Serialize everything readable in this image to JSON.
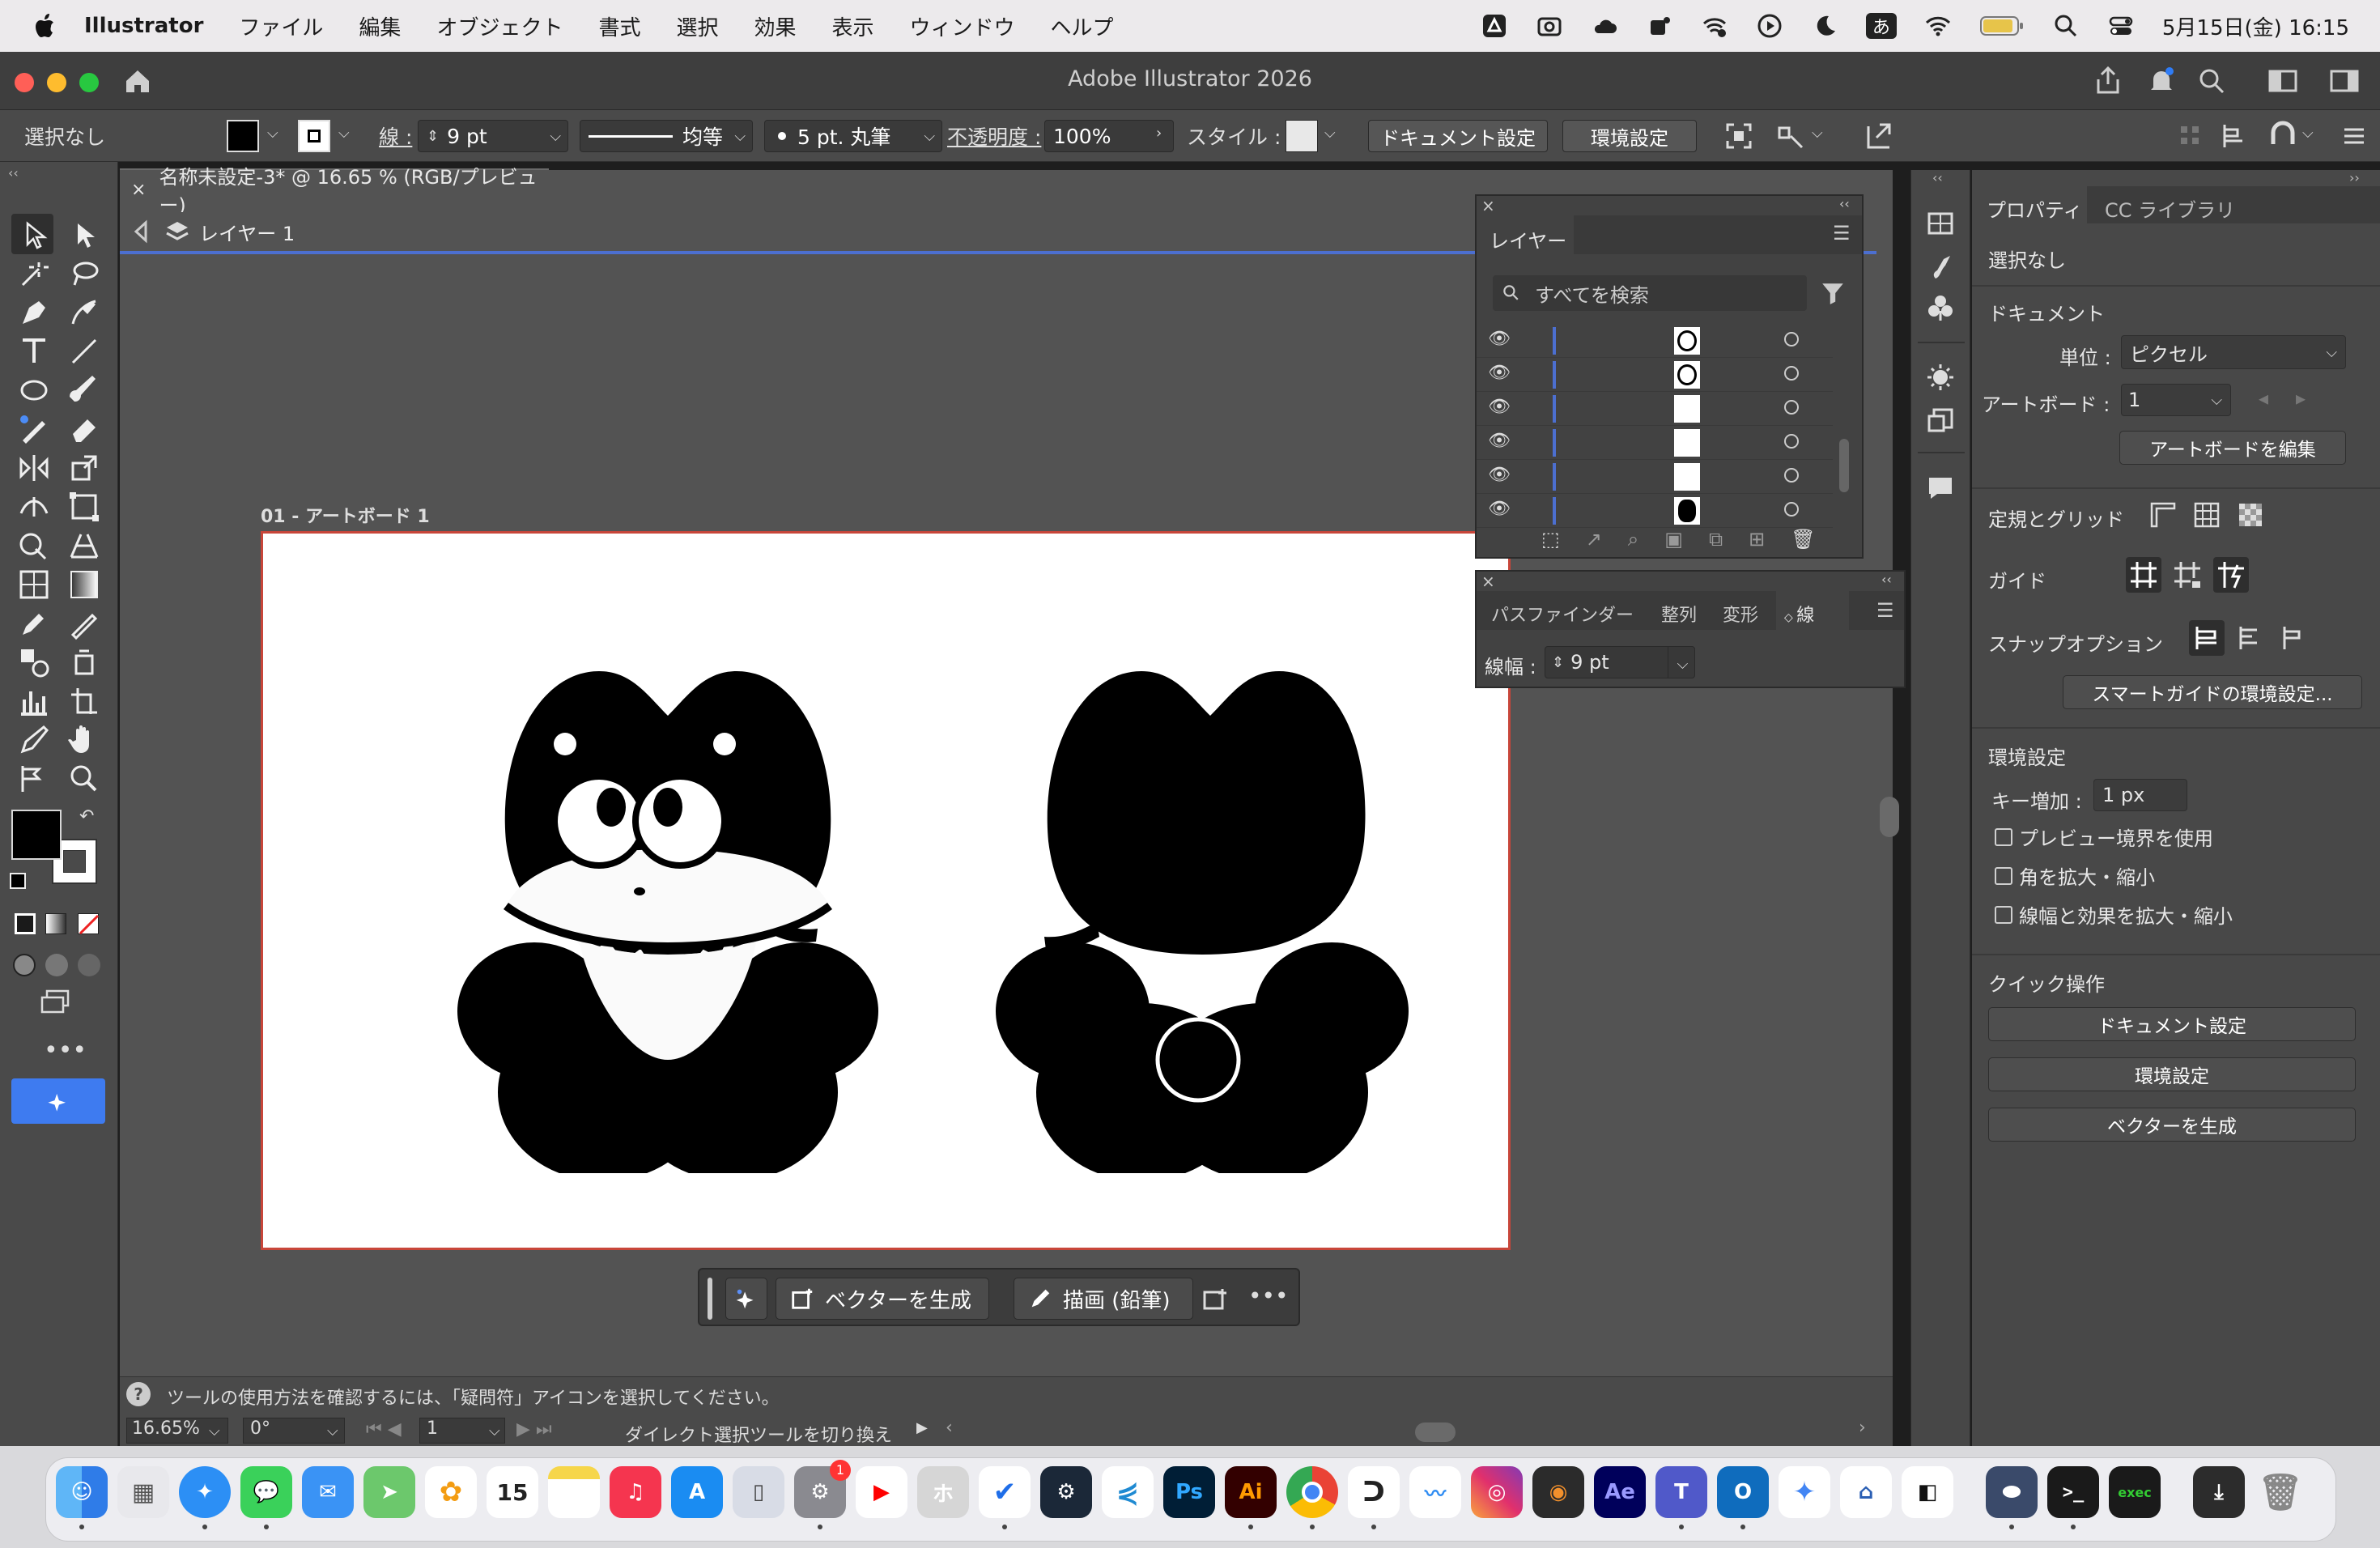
{
  "menubar": {
    "app_name": "Illustrator",
    "items": [
      "ファイル",
      "編集",
      "オブジェクト",
      "書式",
      "選択",
      "効果",
      "表示",
      "ウィンドウ",
      "ヘルプ"
    ],
    "ime": "あ",
    "clock": "5月15日(金) 16:15"
  },
  "window": {
    "title": "Adobe Illustrator 2026"
  },
  "controlbar": {
    "selection": "選択なし",
    "stroke_label": "線 :",
    "stroke_value": "9 pt",
    "profile_label": "均等",
    "brush_label": "5 pt. 丸筆",
    "opacity_label": "不透明度 :",
    "opacity_value": "100%",
    "style_label": "スタイル :",
    "doc_settings": "ドキュメント設定",
    "preferences": "環境設定"
  },
  "document": {
    "tab_title": "名称未設定-3* @ 16.65 % (RGB/プレビュー)",
    "layer_name": "レイヤー 1",
    "artboard_label": "01 - アートボード 1"
  },
  "taskbar": {
    "generate_vector": "ベクターを生成",
    "draw_pencil": "描画 (鉛筆)"
  },
  "statusbar": {
    "hint": "ツールの使用方法を確認するには、「疑問符」アイコンを選択してください。",
    "zoom": "16.65%",
    "rotation": "0°",
    "artboard_num": "1",
    "tool_status": "ダイレクト選択ツールを切り換え"
  },
  "layers_panel": {
    "tab": "レイヤー",
    "search_placeholder": "すべてを検索"
  },
  "stroke_panel": {
    "tabs": [
      "パスファインダー",
      "整列",
      "変形",
      "線"
    ],
    "weight_label": "線幅 :",
    "weight_value": "9 pt"
  },
  "properties": {
    "tabs": [
      "プロパティ",
      "CC ライブラリ"
    ],
    "selection": "選択なし",
    "document_heading": "ドキュメント",
    "unit_label": "単位 :",
    "unit_value": "ピクセル",
    "artboard_label": "アートボード :",
    "artboard_value": "1",
    "edit_artboard": "アートボードを編集",
    "rulers_grids": "定規とグリッド",
    "guides": "ガイド",
    "snap_options": "スナップオプション",
    "smart_guide_prefs": "スマートガイドの環境設定...",
    "preferences_heading": "環境設定",
    "key_increment_label": "キー増加 :",
    "key_increment_value": "1 px",
    "checkbox_preview": "プレビュー境界を使用",
    "checkbox_corners": "角を拡大・縮小",
    "checkbox_strokes": "線幅と効果を拡大・縮小",
    "quick_actions": "クイック操作",
    "qa_doc_settings": "ドキュメント設定",
    "qa_preferences": "環境設定",
    "qa_generate_vector": "ベクターを生成"
  },
  "dock": {
    "calendar_day": "15",
    "settings_badge": "1",
    "apps": [
      "Finder",
      "Launchpad",
      "Safari",
      "Messages",
      "Mail",
      "Maps",
      "Photos",
      "Calendar",
      "Notes",
      "Music",
      "App Store",
      "iPhone Mirroring",
      "System Settings",
      "YouTube",
      "ホ",
      "Tasks",
      "Steam",
      "VS Code",
      "Ps",
      "Ai",
      "Chrome",
      "LINE",
      "Freeform",
      "Instagram",
      "Blender",
      "Ae",
      "Teams",
      "Outlook",
      "Gemini",
      "Toolbox",
      "OpenSquare",
      "Proxyman",
      "Terminal",
      "exec",
      "Downloads",
      "Trash"
    ]
  }
}
